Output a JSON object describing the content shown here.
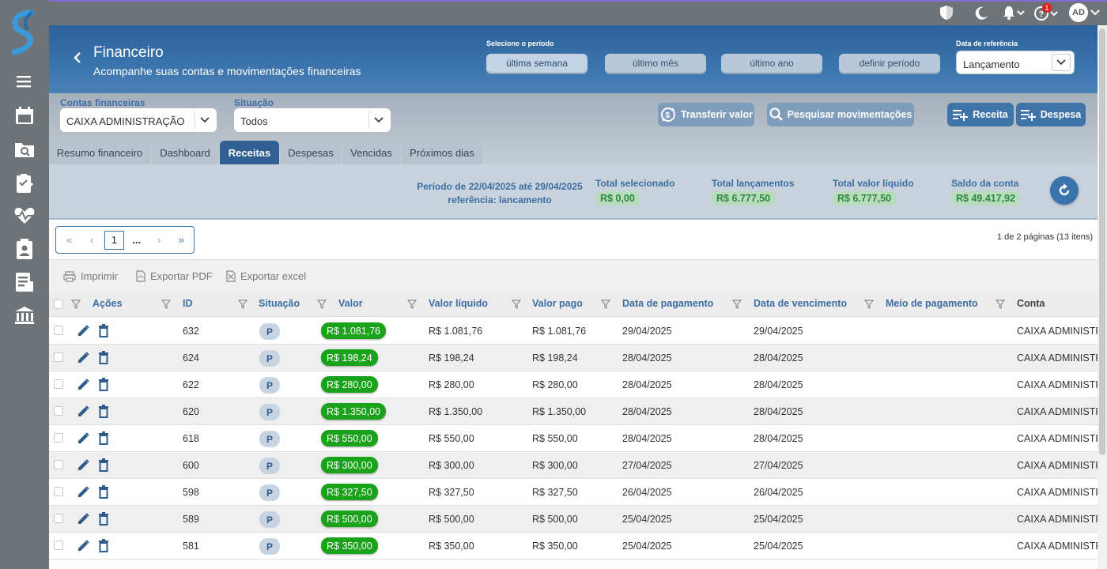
{
  "colors": {
    "header_blue": "#3b74ac",
    "accent_green": "#1aa31a",
    "label_blue": "#3c6ea3"
  },
  "topbar": {
    "avatar_initials": "AD",
    "notification_count": "1"
  },
  "sidebar": {
    "items": [
      "calendar-icon",
      "folder-search-icon",
      "clipboard-check-icon",
      "heart-pulse-icon",
      "clipboard-person-icon",
      "report-icon",
      "bank-icon"
    ]
  },
  "header": {
    "title": "Financeiro",
    "subtitle": "Acompanhe suas contas e movimentações financeiras",
    "period_label": "Selecione o período",
    "period_buttons": [
      "última semana",
      "último mês",
      "último ano",
      "definir período"
    ],
    "reference_label": "Data de referência",
    "reference_value": "Lançamento"
  },
  "filters": {
    "accounts_label": "Contas financeiras",
    "accounts_value": "CAIXA ADMINISTRAÇÃO",
    "status_label": "Situação",
    "status_value": "Todos",
    "transfer_label": "Transferir valor",
    "search_label": "Pesquisar movimentações",
    "income_label": "Receita",
    "expense_label": "Despesa"
  },
  "tabs": [
    "Resumo financeiro",
    "Dashboard",
    "Receitas",
    "Despesas",
    "Vencidas",
    "Próximos dias"
  ],
  "active_tab": "Receitas",
  "summary": {
    "period_line1": "Período de 22/04/2025 até 29/04/2025",
    "period_line2": "referência: lancamento",
    "stats": [
      {
        "label": "Total selecionado",
        "value": "R$ 0,00"
      },
      {
        "label": "Total lançamentos",
        "value": "R$ 6.777,50"
      },
      {
        "label": "Total valor líquido",
        "value": "R$ 6.777,50"
      },
      {
        "label": "Saldo da conta",
        "value": "R$ 49.417,92"
      }
    ]
  },
  "pagination": {
    "first": "«",
    "prev": "‹",
    "current": "1",
    "dots": "...",
    "next": "›",
    "last": "»",
    "info": "1 de 2 páginas (13 itens)"
  },
  "toolbar": {
    "print": "Imprimir",
    "pdf": "Exportar PDF",
    "excel": "Exportar excel"
  },
  "table": {
    "headers": [
      "Ações",
      "ID",
      "Situação",
      "Valor",
      "Valor líquido",
      "Valor pago",
      "Data de pagamento",
      "Data de vencimento",
      "Meio de pagamento",
      "Conta"
    ],
    "rows": [
      {
        "id": "632",
        "status": "P",
        "value": "R$ 1.081,76",
        "net": "R$ 1.081,76",
        "paid": "R$ 1.081,76",
        "pay_date": "29/04/2025",
        "due_date": "29/04/2025",
        "method": "",
        "account": "CAIXA ADMINISTRA"
      },
      {
        "id": "624",
        "status": "P",
        "value": "R$ 198,24",
        "net": "R$ 198,24",
        "paid": "R$ 198,24",
        "pay_date": "28/04/2025",
        "due_date": "28/04/2025",
        "method": "",
        "account": "CAIXA ADMINISTRA"
      },
      {
        "id": "622",
        "status": "P",
        "value": "R$ 280,00",
        "net": "R$ 280,00",
        "paid": "R$ 280,00",
        "pay_date": "28/04/2025",
        "due_date": "28/04/2025",
        "method": "",
        "account": "CAIXA ADMINISTRA"
      },
      {
        "id": "620",
        "status": "P",
        "value": "R$ 1.350,00",
        "net": "R$ 1.350,00",
        "paid": "R$ 1.350,00",
        "pay_date": "28/04/2025",
        "due_date": "28/04/2025",
        "method": "",
        "account": "CAIXA ADMINISTRA"
      },
      {
        "id": "618",
        "status": "P",
        "value": "R$ 550,00",
        "net": "R$ 550,00",
        "paid": "R$ 550,00",
        "pay_date": "28/04/2025",
        "due_date": "28/04/2025",
        "method": "",
        "account": "CAIXA ADMINISTRA"
      },
      {
        "id": "600",
        "status": "P",
        "value": "R$ 300,00",
        "net": "R$ 300,00",
        "paid": "R$ 300,00",
        "pay_date": "27/04/2025",
        "due_date": "27/04/2025",
        "method": "",
        "account": "CAIXA ADMINISTRA"
      },
      {
        "id": "598",
        "status": "P",
        "value": "R$ 327,50",
        "net": "R$ 327,50",
        "paid": "R$ 327,50",
        "pay_date": "26/04/2025",
        "due_date": "26/04/2025",
        "method": "",
        "account": "CAIXA ADMINISTRA"
      },
      {
        "id": "589",
        "status": "P",
        "value": "R$ 500,00",
        "net": "R$ 500,00",
        "paid": "R$ 500,00",
        "pay_date": "25/04/2025",
        "due_date": "25/04/2025",
        "method": "",
        "account": "CAIXA ADMINISTRA"
      },
      {
        "id": "581",
        "status": "P",
        "value": "R$ 350,00",
        "net": "R$ 350,00",
        "paid": "R$ 350,00",
        "pay_date": "25/04/2025",
        "due_date": "25/04/2025",
        "method": "",
        "account": "CAIXA ADMINISTRA"
      }
    ]
  }
}
